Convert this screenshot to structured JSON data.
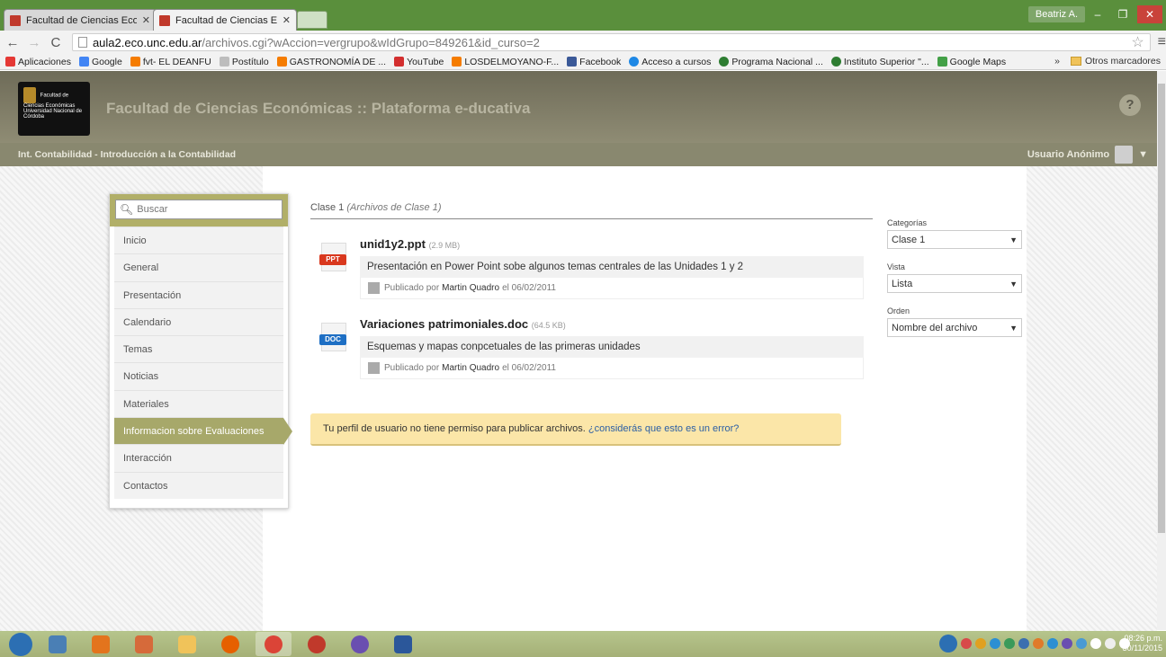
{
  "browser": {
    "tabs": [
      {
        "label": "Facultad de Ciencias Econ"
      },
      {
        "label": "Facultad de Ciencias Econ"
      }
    ],
    "user": "Beatriz A.",
    "url_host": "aula2.eco.unc.edu.ar",
    "url_path": "/archivos.cgi?wAccion=vergrupo&wIdGrupo=849261&id_curso=2",
    "bookmarks": [
      {
        "label": "Aplicaciones",
        "color": "#e53935"
      },
      {
        "label": "Google",
        "color": "#4285f4"
      },
      {
        "label": "fvt- EL DEANFU",
        "color": "#f57c00"
      },
      {
        "label": "Postítulo",
        "color": "#bdbdbd"
      },
      {
        "label": "GASTRONOMÍA DE ...",
        "color": "#f57c00"
      },
      {
        "label": "YouTube",
        "color": "#d32f2f"
      },
      {
        "label": "LOSDELMOYANO-F...",
        "color": "#f57c00"
      },
      {
        "label": "Facebook",
        "color": "#3b5998"
      },
      {
        "label": "Acceso a cursos",
        "color": "#1e88e5"
      },
      {
        "label": "Programa Nacional ...",
        "color": "#2e7d32"
      },
      {
        "label": "Instituto Superior \"...",
        "color": "#2e7d32"
      },
      {
        "label": "Google Maps",
        "color": "#43a047"
      }
    ],
    "bookmarks_more": "»",
    "other_bookmarks": "Otros marcadores"
  },
  "header": {
    "logo_text": "Facultad de Ciencias Económicas Universidad Nacional de Córdoba",
    "title": "Facultad de Ciencias Económicas :: Plataforma e-ducativa",
    "help": "?",
    "course": "Int. Contabilidad - Introducción a la Contabilidad",
    "user": "Usuario Anónimo"
  },
  "sidebar": {
    "search_placeholder": "Buscar",
    "items": [
      {
        "label": "Inicio"
      },
      {
        "label": "General"
      },
      {
        "label": "Presentación"
      },
      {
        "label": "Calendario"
      },
      {
        "label": "Temas"
      },
      {
        "label": "Noticias"
      },
      {
        "label": "Materiales"
      },
      {
        "label": "Informacion sobre Evaluaciones"
      },
      {
        "label": "Interacción"
      },
      {
        "label": "Contactos"
      }
    ]
  },
  "main": {
    "section_title": "Clase 1",
    "section_subtitle": "(Archivos de Clase 1)",
    "files": [
      {
        "name": "unid1y2.ppt",
        "size": "(2.9 MB)",
        "type": "PPT",
        "type_color": "#d9381e",
        "description": "Presentación en Power Point sobe algunos temas centrales de las Unidades 1 y 2",
        "published_prefix": "Publicado por",
        "author": "Martin Quadro",
        "date": "el 06/02/2011"
      },
      {
        "name": "Variaciones patrimoniales.doc",
        "size": "(64.5 KB)",
        "type": "DOC",
        "type_color": "#1e6fc4",
        "description": "Esquemas y mapas conpcetuales de las primeras unidades",
        "published_prefix": "Publicado por",
        "author": "Martin Quadro",
        "date": "el 06/02/2011"
      }
    ],
    "notice_text": "Tu perfil de usuario no tiene permiso para publicar archivos.",
    "notice_link": "¿considerás que esto es un error?"
  },
  "filters": {
    "categorias_label": "Categorías",
    "categorias_value": "Clase 1",
    "vista_label": "Vista",
    "vista_value": "Lista",
    "orden_label": "Orden",
    "orden_value": "Nombre del archivo"
  },
  "taskbar": {
    "time": "08:26 p.m.",
    "date": "30/11/2015"
  }
}
